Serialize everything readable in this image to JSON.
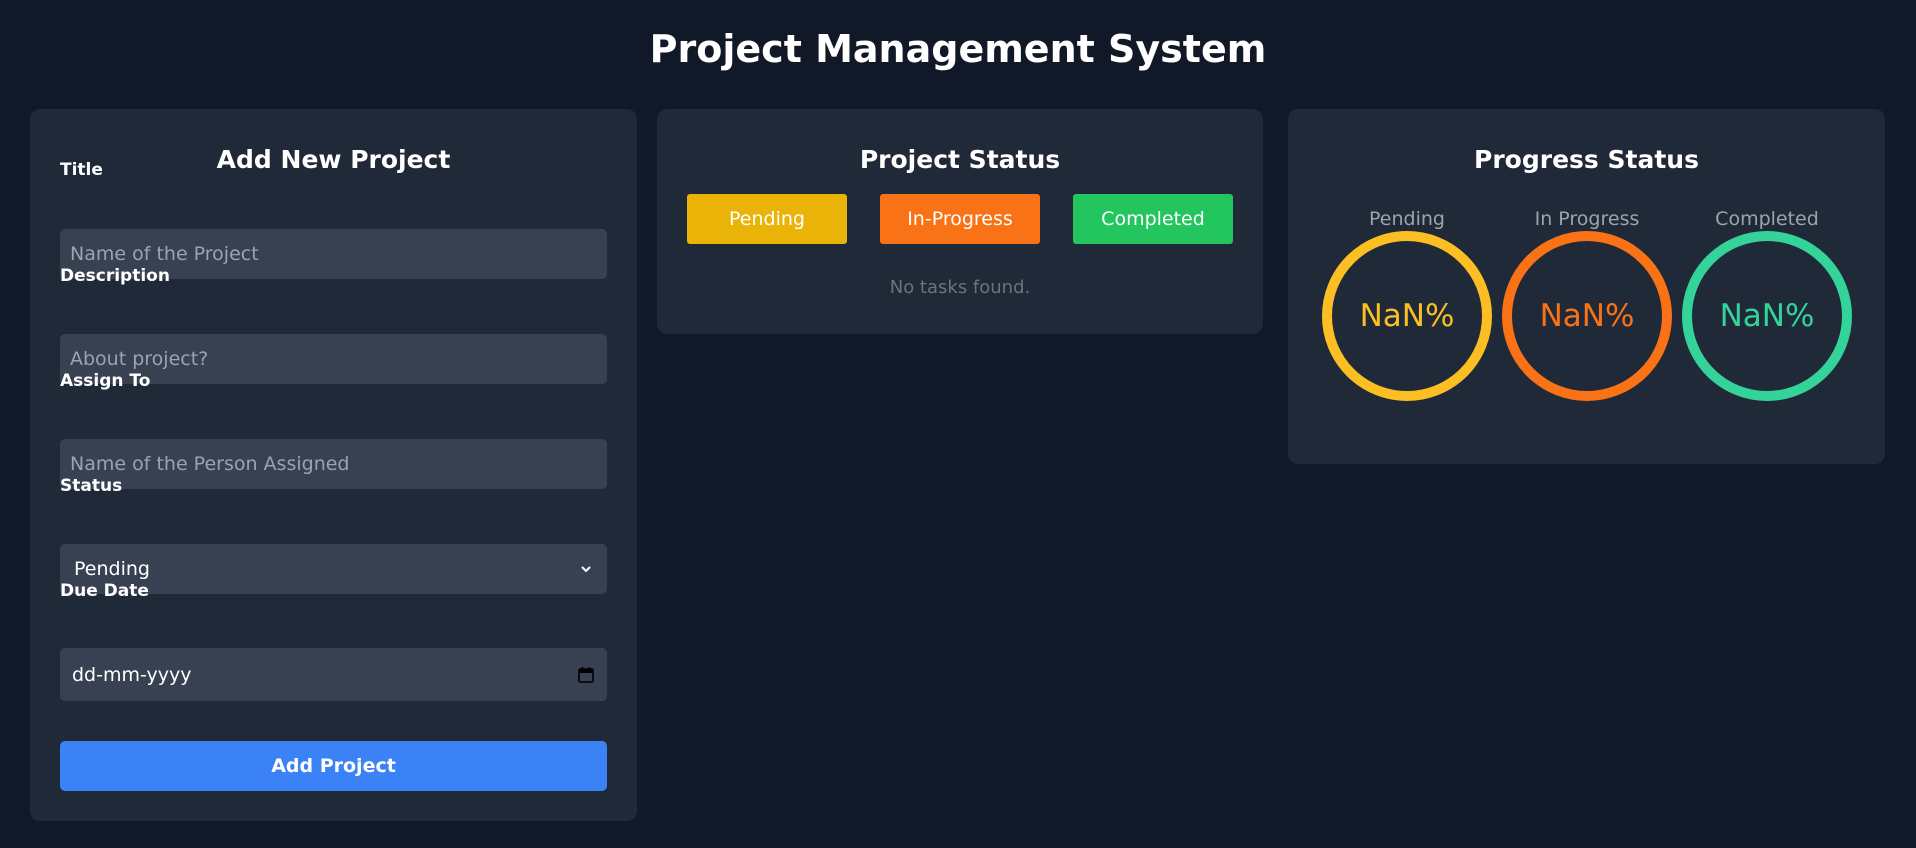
{
  "page_title": "Project Management System",
  "form": {
    "title": "Add New Project",
    "fields": {
      "title": {
        "label": "Title",
        "placeholder": "Name of the Project"
      },
      "description": {
        "label": "Description",
        "placeholder": "About project?"
      },
      "assign": {
        "label": "Assign To",
        "placeholder": "Name of the Person Assigned"
      },
      "status": {
        "label": "Status",
        "value": "Pending"
      },
      "due": {
        "label": "Due Date",
        "value": "dd-mm-yyyy"
      }
    },
    "submit_label": "Add Project"
  },
  "status_panel": {
    "title": "Project Status",
    "buttons": [
      {
        "label": "Pending",
        "color": "#eab308"
      },
      {
        "label": "In-Progress",
        "color": "#f97316"
      },
      {
        "label": "Completed",
        "color": "#22c55e"
      }
    ],
    "empty_message": "No tasks found."
  },
  "progress_panel": {
    "title": "Progress Status",
    "rings": [
      {
        "label": "Pending",
        "value": "NaN%",
        "color": "#fbbf24"
      },
      {
        "label": "In Progress",
        "value": "NaN%",
        "color": "#f97316"
      },
      {
        "label": "Completed",
        "value": "NaN%",
        "color": "#34d399"
      }
    ]
  }
}
